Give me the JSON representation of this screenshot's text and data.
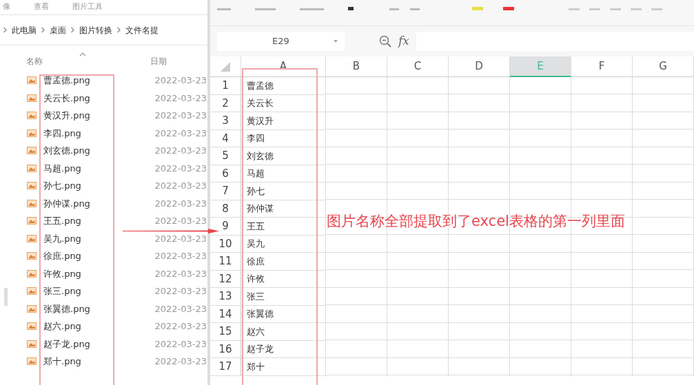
{
  "explorer": {
    "ribbon_tabs": [
      "像",
      "查看",
      "图片工具"
    ],
    "breadcrumb": [
      "此电脑",
      "桌面",
      "图片转换",
      "文件名提"
    ],
    "columns": [
      "名称",
      "日期"
    ],
    "files": [
      {
        "name": "曹孟德.png",
        "date": "2022-03-23"
      },
      {
        "name": "关云长.png",
        "date": "2022-03-23"
      },
      {
        "name": "黄汉升.png",
        "date": "2022-03-23"
      },
      {
        "name": "李四.png",
        "date": "2022-03-23"
      },
      {
        "name": "刘玄德.png",
        "date": "2022-03-23"
      },
      {
        "name": "马超.png",
        "date": "2022-03-23"
      },
      {
        "name": "孙七.png",
        "date": "2022-03-23"
      },
      {
        "name": "孙仲谋.png",
        "date": "2022-03-23"
      },
      {
        "name": "王五.png",
        "date": "2022-03-23"
      },
      {
        "name": "吴九.png",
        "date": "2022-03-23"
      },
      {
        "name": "徐庶.png",
        "date": "2022-03-23"
      },
      {
        "name": "许攸.png",
        "date": "2022-03-23"
      },
      {
        "name": "张三.png",
        "date": "2022-03-23"
      },
      {
        "name": "张翼德.png",
        "date": "2022-03-23"
      },
      {
        "name": "赵六.png",
        "date": "2022-03-23"
      },
      {
        "name": "赵子龙.png",
        "date": "2022-03-23"
      },
      {
        "name": "郑十.png",
        "date": "2022-03-23"
      }
    ]
  },
  "spreadsheet": {
    "name_box": "E29",
    "formula_label": "fx",
    "columns": [
      {
        "label": "A",
        "selected": false
      },
      {
        "label": "B",
        "selected": false
      },
      {
        "label": "C",
        "selected": false
      },
      {
        "label": "D",
        "selected": false
      },
      {
        "label": "E",
        "selected": true
      },
      {
        "label": "F",
        "selected": false
      },
      {
        "label": "G",
        "selected": false
      }
    ],
    "rows": [
      {
        "number": "1",
        "cell_a": "曹孟德"
      },
      {
        "number": "2",
        "cell_a": "关云长"
      },
      {
        "number": "3",
        "cell_a": "黄汉升"
      },
      {
        "number": "4",
        "cell_a": "李四"
      },
      {
        "number": "5",
        "cell_a": "刘玄德"
      },
      {
        "number": "6",
        "cell_a": "马超"
      },
      {
        "number": "7",
        "cell_a": "孙七"
      },
      {
        "number": "8",
        "cell_a": "孙仲谋"
      },
      {
        "number": "9",
        "cell_a": "王五"
      },
      {
        "number": "10",
        "cell_a": "吴九"
      },
      {
        "number": "11",
        "cell_a": "徐庶"
      },
      {
        "number": "12",
        "cell_a": "许攸"
      },
      {
        "number": "13",
        "cell_a": "张三"
      },
      {
        "number": "14",
        "cell_a": "张翼德"
      },
      {
        "number": "15",
        "cell_a": "赵六"
      },
      {
        "number": "16",
        "cell_a": "赵子龙"
      },
      {
        "number": "17",
        "cell_a": "郑十"
      }
    ]
  },
  "annotation": {
    "text": "图片名称全部提取到了excel表格的第一列里面"
  }
}
